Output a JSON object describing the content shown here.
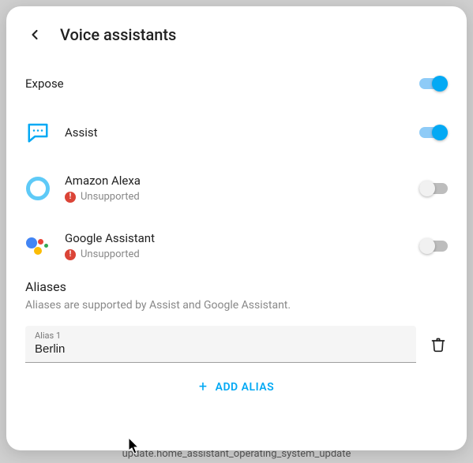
{
  "backdrop_text": "update.home_assistant_operating_system_update",
  "dialog": {
    "title": "Voice assistants"
  },
  "expose": {
    "label": "Expose",
    "enabled": true
  },
  "assistants": [
    {
      "id": "assist",
      "label": "Assist",
      "enabled": true,
      "unsupported": false
    },
    {
      "id": "alexa",
      "label": "Amazon Alexa",
      "enabled": false,
      "unsupported": true,
      "unsupported_label": "Unsupported"
    },
    {
      "id": "google",
      "label": "Google Assistant",
      "enabled": false,
      "unsupported": true,
      "unsupported_label": "Unsupported"
    }
  ],
  "aliases": {
    "heading": "Aliases",
    "description": "Aliases are supported by Assist and Google Assistant.",
    "items": [
      {
        "label": "Alias 1",
        "value": "Berlin"
      }
    ],
    "add_label": "ADD ALIAS"
  }
}
